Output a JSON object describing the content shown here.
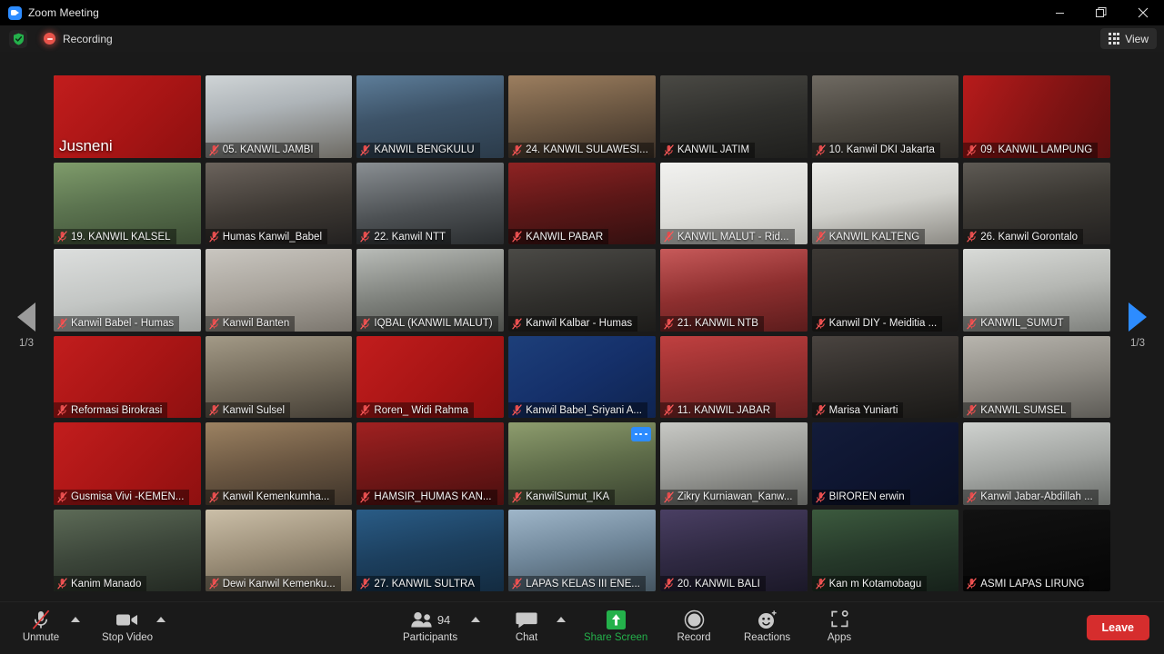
{
  "window": {
    "title": "Zoom Meeting",
    "app_icon": "zoom-logo-icon",
    "minimize": "minimize-icon",
    "maximize": "maximize-icon",
    "close": "close-icon"
  },
  "header": {
    "shield_icon": "encryption-shield-icon",
    "recording_icon": "recording-dot-icon",
    "recording_label": "Recording",
    "view_button": {
      "label": "View",
      "icon": "grid-view-icon"
    }
  },
  "gallery": {
    "columns": 7,
    "rows": 6,
    "pager_left": {
      "icon": "chevron-left-arrow-icon",
      "page": "1/3"
    },
    "pager_right": {
      "icon": "chevron-right-arrow-icon",
      "page": "1/3"
    },
    "tiles": [
      {
        "name": "Jusneni",
        "muted": false,
        "active": true,
        "style": "logo-red",
        "big": true
      },
      {
        "name": "05. KANWIL JAMBI",
        "muted": true,
        "style": "room-light"
      },
      {
        "name": "KANWIL BENGKULU",
        "muted": true,
        "style": "room-blue"
      },
      {
        "name": "24. KANWIL SULAWESI...",
        "muted": true,
        "style": "room-banner"
      },
      {
        "name": "KANWIL JATIM",
        "muted": true,
        "style": "room-dark"
      },
      {
        "name": "10. Kanwil DKI Jakarta",
        "muted": true,
        "style": "room-office"
      },
      {
        "name": "09. KANWIL LAMPUNG",
        "muted": true,
        "style": "logo-red2"
      },
      {
        "name": "19. KANWIL KALSEL",
        "muted": true,
        "style": "room-green"
      },
      {
        "name": "Humas Kanwil_Babel",
        "muted": true,
        "style": "person-dark"
      },
      {
        "name": "22. Kanwil NTT",
        "muted": true,
        "style": "person-group"
      },
      {
        "name": "KANWIL PABAR",
        "muted": true,
        "style": "room-red"
      },
      {
        "name": "KANWIL MALUT - Rid...",
        "muted": true,
        "style": "room-white"
      },
      {
        "name": "KANWIL KALTENG",
        "muted": true,
        "style": "person-white"
      },
      {
        "name": "26. Kanwil Gorontalo",
        "muted": true,
        "style": "room-table"
      },
      {
        "name": "Kanwil Babel - Humas",
        "muted": true,
        "style": "room-plain"
      },
      {
        "name": "Kanwil Banten",
        "muted": true,
        "style": "person-mask"
      },
      {
        "name": "IQBAL (KANWIL MALUT)",
        "muted": true,
        "style": "room-desk"
      },
      {
        "name": "Kanwil Kalbar - Humas",
        "muted": true,
        "style": "room-dim"
      },
      {
        "name": "21. KANWIL NTB",
        "muted": true,
        "style": "room-pink"
      },
      {
        "name": "Kanwil DIY - Meiditia ...",
        "muted": true,
        "style": "person-mask2"
      },
      {
        "name": "KANWIL_SUMUT",
        "muted": true,
        "style": "person-man"
      },
      {
        "name": "Reformasi Birokrasi",
        "muted": true,
        "style": "logo-red"
      },
      {
        "name": "Kanwil Sulsel",
        "muted": true,
        "style": "room-two"
      },
      {
        "name": "Roren_ Widi Rahma",
        "muted": true,
        "style": "logo-red"
      },
      {
        "name": "Kanwil Babel_Sriyani A...",
        "muted": true,
        "style": "slide-blue"
      },
      {
        "name": "11. KANWIL JABAR",
        "muted": true,
        "style": "two-women"
      },
      {
        "name": "Marisa Yuniarti",
        "muted": true,
        "style": "person-dark2"
      },
      {
        "name": "KANWIL SUMSEL",
        "muted": true,
        "style": "person-batik"
      },
      {
        "name": "Gusmisa Vivi -KEMEN...",
        "muted": true,
        "style": "logo-red"
      },
      {
        "name": "Kanwil Kemenkumha...",
        "muted": true,
        "style": "room-wood"
      },
      {
        "name": "HAMSIR_HUMAS KAN...",
        "muted": true,
        "style": "banner-red"
      },
      {
        "name": "KanwilSumut_IKA",
        "muted": true,
        "style": "person-outdoor",
        "menu": true
      },
      {
        "name": "Zikry Kurniawan_Kanw...",
        "muted": true,
        "style": "person-mask3"
      },
      {
        "name": "BIROREN erwin",
        "muted": true,
        "style": "logo-map"
      },
      {
        "name": "Kanwil Jabar-Abdillah ...",
        "muted": true,
        "style": "person-mask4"
      },
      {
        "name": "Kanim Manado",
        "muted": true,
        "style": "room-tv"
      },
      {
        "name": "Dewi Kanwil Kemenku...",
        "muted": true,
        "style": "person-hijab"
      },
      {
        "name": "27. KANWIL SULTRA",
        "muted": true,
        "style": "banner-human"
      },
      {
        "name": "LAPAS KELAS III ENE...",
        "muted": true,
        "style": "room-blue2"
      },
      {
        "name": "20. KANWIL BALI",
        "muted": true,
        "style": "person-udeng"
      },
      {
        "name": "Kan m Kotamobagu",
        "muted": true,
        "style": "room-flag"
      },
      {
        "name": "ASMI LAPAS LIRUNG",
        "muted": true,
        "style": "black"
      }
    ]
  },
  "toolbar": {
    "mute": {
      "label": "Unmute",
      "icon": "microphone-muted-icon",
      "caret": "audio-options-caret"
    },
    "video": {
      "label": "Stop Video",
      "icon": "video-camera-icon",
      "caret": "video-options-caret"
    },
    "participants": {
      "label": "Participants",
      "icon": "participants-icon",
      "count": "94",
      "caret": "participants-caret"
    },
    "chat": {
      "label": "Chat",
      "icon": "chat-bubble-icon",
      "caret": "chat-caret"
    },
    "share": {
      "label": "Share Screen",
      "icon": "share-screen-icon"
    },
    "record": {
      "label": "Record",
      "icon": "record-circle-icon"
    },
    "reactions": {
      "label": "Reactions",
      "icon": "reactions-smiley-icon"
    },
    "apps": {
      "label": "Apps",
      "icon": "apps-bracket-icon"
    },
    "leave": {
      "label": "Leave"
    }
  },
  "colors": {
    "accent_blue": "#2d8cff",
    "leave_red": "#d62d2d",
    "share_green": "#24b14b",
    "active_border": "#d9e021",
    "bg": "#1a1a1a"
  }
}
